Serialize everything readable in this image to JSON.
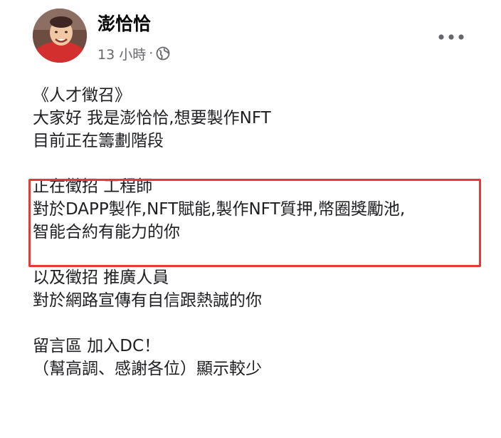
{
  "post": {
    "author": "澎恰恰",
    "time": "13 小時",
    "separator": "·",
    "privacy_icon": "globe-icon",
    "more_icon": "more-options-icon",
    "lines": [
      "《人才徵召》",
      "大家好 我是澎恰恰,想要製作NFT",
      "目前正在籌劃階段",
      "",
      "正在徵招 工程師",
      "對於DAPP製作,NFT賦能,製作NFT質押,幣圈獎勵池,",
      "智能合約有能力的你",
      "",
      "以及徵招 推廣人員",
      "對於網路宣傳有自信跟熱誠的你",
      "",
      "留言區 加入DC！",
      "（幫高調、感謝各位）顯示較少"
    ]
  },
  "colors": {
    "highlight_border": "#e53935",
    "secondary_text": "#65676b",
    "primary_text": "#1c1e21"
  }
}
